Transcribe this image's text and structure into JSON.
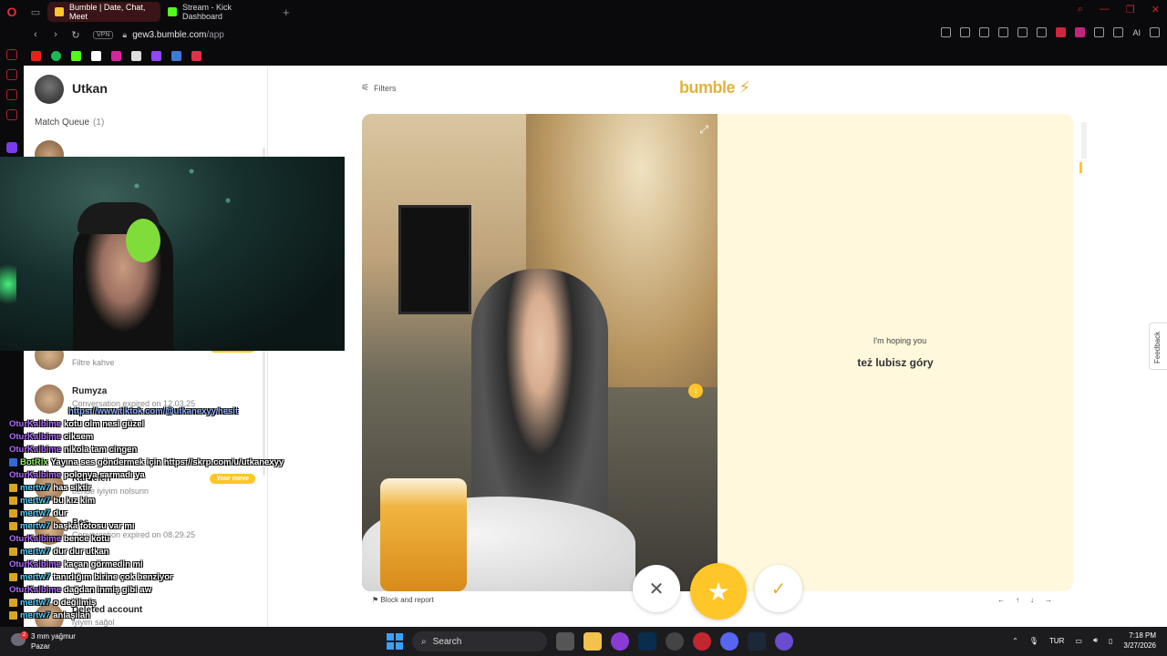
{
  "browser": {
    "tabs": [
      {
        "title": "Bumble | Date, Chat, Meet",
        "favicon_color": "#ffc629",
        "active": true
      },
      {
        "title": "Stream - Kick Dashboard",
        "favicon_color": "#53fc18",
        "active": false
      }
    ],
    "vpn_label": "VPN",
    "url_host": "gew3.bumble.com",
    "url_path": "/app",
    "ai_label": "AI",
    "bookmarks": [
      "youtube",
      "spotify",
      "kick",
      "x",
      "instagram",
      "tiktok",
      "twitch",
      "steam",
      "discord"
    ]
  },
  "left_pane": {
    "user_name": "Utkan",
    "match_queue_label": "Match Queue",
    "match_queue_count": "(1)",
    "conversations": [
      {
        "name": "",
        "message": "Filtre kahve",
        "your_move": true
      },
      {
        "name": "Rumyza",
        "message": "Conversation expired on 12.03.25",
        "your_move": false
      },
      {
        "name": "Kardelen",
        "message": "bende iyiyim nolsunn",
        "your_move": true
      },
      {
        "name": "Bes",
        "message": "Conversation expired on 08.29.25",
        "your_move": false
      },
      {
        "name": "Deleted account",
        "message": "iyiyim sağol",
        "your_move": false
      }
    ],
    "your_move_label": "Your move"
  },
  "main": {
    "filters_label": "Filters",
    "logo_text": "bumble",
    "prompt_label": "I'm hoping you",
    "prompt_answer": "też lubisz góry",
    "block_report_label": "Block and report",
    "keyboard_hints": [
      "←",
      "↑",
      "↓",
      "→"
    ],
    "feedback_label": "Feedback",
    "accent_color": "#ffc629"
  },
  "chat": [
    {
      "user": "",
      "color": "#b06cff",
      "message": "https://www.tiktok.com/@utkanexyy.hesit",
      "link": true
    },
    {
      "user": "OturKalbime",
      "color": "#b06cff",
      "message": "kotu olm nesi güzel",
      "link": false
    },
    {
      "user": "OturKalbime",
      "color": "#b06cff",
      "message": "ciksem",
      "link": false
    },
    {
      "user": "OturKalbime",
      "color": "#b06cff",
      "message": "nikola tam cingen",
      "link": false
    },
    {
      "user": "BotRix",
      "color": "#8ef060",
      "message": "Yayına ses göndermek için https://skrp.com/u/utkanexyy",
      "link": false
    },
    {
      "user": "OturKalbime",
      "color": "#b06cff",
      "message": "polonya sarmadı ya",
      "link": false
    },
    {
      "user": "mertw7",
      "color": "#4fd1ff",
      "message": "has siktir",
      "link": false
    },
    {
      "user": "mertw7",
      "color": "#4fd1ff",
      "message": "bu kız kim",
      "link": false
    },
    {
      "user": "mertw7",
      "color": "#4fd1ff",
      "message": "dur",
      "link": false
    },
    {
      "user": "mertw7",
      "color": "#4fd1ff",
      "message": "başka fotosu var mı",
      "link": false
    },
    {
      "user": "OturKalbime",
      "color": "#b06cff",
      "message": "bence kotu",
      "link": false
    },
    {
      "user": "mertw7",
      "color": "#4fd1ff",
      "message": "dur dur utkan",
      "link": false
    },
    {
      "user": "OturKalbime",
      "color": "#b06cff",
      "message": "kaçan görmedin mi",
      "link": false
    },
    {
      "user": "mertw7",
      "color": "#4fd1ff",
      "message": "tanıdığım birine çok benziyor",
      "link": false
    },
    {
      "user": "OturKalbime",
      "color": "#b06cff",
      "message": "dağdan inmiş gibi aw",
      "link": false
    },
    {
      "user": "mertw7",
      "color": "#4fd1ff",
      "message": "o değilmiş",
      "link": false
    },
    {
      "user": "mertw7",
      "color": "#4fd1ff",
      "message": "anlaşılan",
      "link": false
    }
  ],
  "taskbar": {
    "weather_temp": "3 mm yağmur",
    "weather_day": "Pazar",
    "weather_badge": "2",
    "search_label": "Search",
    "language": "TUR",
    "time": "7:18 PM",
    "date": "3/27/2026"
  }
}
